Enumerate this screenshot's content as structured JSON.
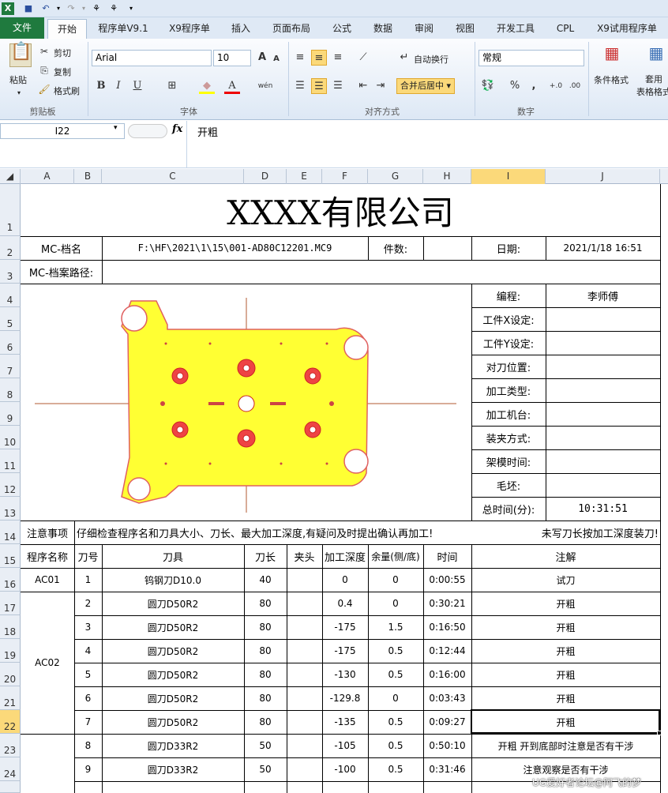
{
  "tabs": {
    "file": "文件",
    "items": [
      "开始",
      "程序单V9.1",
      "X9程序单",
      "插入",
      "页面布局",
      "公式",
      "数据",
      "审阅",
      "视图",
      "开发工具",
      "CPL",
      "X9试用程序单"
    ]
  },
  "ribbon": {
    "paste": "粘贴",
    "cut": "剪切",
    "copy": "复制",
    "format_painter": "格式刷",
    "clipboard_label": "剪贴板",
    "font_name": "Arial",
    "font_size": "10",
    "font_label": "字体",
    "wrap_text": "自动换行",
    "merge_center": "合并后居中",
    "align_label": "对齐方式",
    "number_format": "常规",
    "number_label": "数字",
    "cond_format": "条件格式",
    "table_format": "套用\n表格格式",
    "bold": "B",
    "italic": "I",
    "underline": "U",
    "percent": "%",
    "comma": ",",
    "increase_font": "A",
    "decrease_font": "A",
    "font_color": "A",
    "phonetic": "wén"
  },
  "formula_bar": {
    "name_box": "I22",
    "fx": "fx",
    "value": "开粗"
  },
  "columns": [
    "A",
    "B",
    "C",
    "D",
    "E",
    "F",
    "G",
    "H",
    "I",
    "J"
  ],
  "rows": [
    "1",
    "2",
    "3",
    "4",
    "5",
    "6",
    "7",
    "8",
    "9",
    "10",
    "11",
    "12",
    "13",
    "14",
    "15",
    "16",
    "17",
    "18",
    "19",
    "20",
    "21",
    "22",
    "23",
    "24"
  ],
  "sheet": {
    "company": "XXXX有限公司",
    "mc_file_label": "MC-档名",
    "mc_file": "F:\\HF\\2021\\1\\15\\001-AD80C12201.MC9",
    "count_label": "件数:",
    "date_label": "日期:",
    "date": "2021/1/18 16:51",
    "path_label": "MC-档案路径:",
    "info_labels": [
      "编程:",
      "工件X设定:",
      "工件Y设定:",
      "对刀位置:",
      "加工类型:",
      "加工机台:",
      "装夹方式:",
      "架模时间:",
      "毛坯:",
      "总时间(分):"
    ],
    "programmer": "李师傅",
    "total_time": "10:31:51",
    "notice_label": "注意事项",
    "notice_text": "仔细检查程序名和刀具大小、刀长、最大加工深度,有疑问及时提出确认再加工!",
    "notice_text2": "未写刀长按加工深度装刀!",
    "headers": [
      "程序名称",
      "刀号",
      "刀具",
      "刀长",
      "夹头",
      "加工深度",
      "余量(侧/底)",
      "时间",
      "注解"
    ]
  },
  "table_rows": [
    {
      "prog": "AC01",
      "no": "1",
      "tool": "钨钢刀D10.0",
      "len": "40",
      "depth": "0",
      "stock": "0",
      "time": "0:00:55",
      "note": "试刀"
    },
    {
      "prog": "",
      "no": "2",
      "tool": "圆刀D50R2",
      "len": "80",
      "depth": "0.4",
      "stock": "0",
      "time": "0:30:21",
      "note": "开粗"
    },
    {
      "prog": "",
      "no": "3",
      "tool": "圆刀D50R2",
      "len": "80",
      "depth": "-175",
      "stock": "1.5",
      "time": "0:16:50",
      "note": "开粗"
    },
    {
      "prog": "AC02",
      "no": "4",
      "tool": "圆刀D50R2",
      "len": "80",
      "depth": "-175",
      "stock": "0.5",
      "time": "0:12:44",
      "note": "开粗"
    },
    {
      "prog": "",
      "no": "5",
      "tool": "圆刀D50R2",
      "len": "80",
      "depth": "-130",
      "stock": "0.5",
      "time": "0:16:00",
      "note": "开粗"
    },
    {
      "prog": "",
      "no": "6",
      "tool": "圆刀D50R2",
      "len": "80",
      "depth": "-129.8",
      "stock": "0",
      "time": "0:03:43",
      "note": "开粗"
    },
    {
      "prog": "",
      "no": "7",
      "tool": "圆刀D50R2",
      "len": "80",
      "depth": "-135",
      "stock": "0.5",
      "time": "0:09:27",
      "note": "开粗"
    },
    {
      "prog": "",
      "no": "8",
      "tool": "圆刀D33R2",
      "len": "50",
      "depth": "-105",
      "stock": "0.5",
      "time": "0:50:10",
      "note": "开粗 开到底部时注意是否有干涉"
    },
    {
      "prog": "",
      "no": "9",
      "tool": "圆刀D33R2",
      "len": "50",
      "depth": "-100",
      "stock": "0.5",
      "time": "0:31:46",
      "note": "注意观察是否有干涉"
    }
  ],
  "watermark": "UG爱好者论坛@阿飞的梦",
  "colors": {
    "file_tab": "#1f7a3e",
    "part_fill": "#ffff33",
    "part_edge": "#e06060",
    "selected_col": "#fbd97a"
  }
}
